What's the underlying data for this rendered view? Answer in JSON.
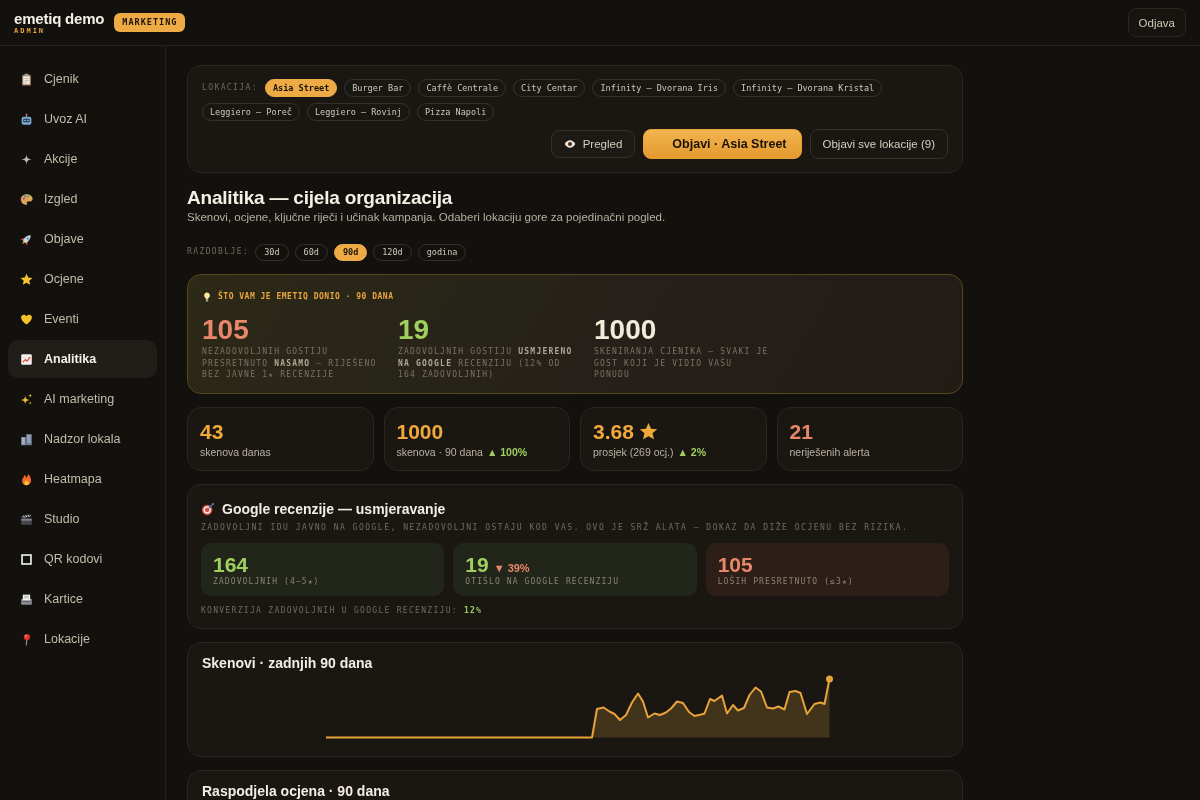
{
  "header": {
    "brand": "emetiq demo",
    "role": "ADMIN",
    "badge": "MARKETING",
    "logout": "Odjava"
  },
  "sidebar": {
    "items": [
      {
        "label": "Cjenik",
        "selected": false
      },
      {
        "label": "Uvoz AI",
        "selected": false
      },
      {
        "label": "Akcije",
        "selected": false
      },
      {
        "label": "Izgled",
        "selected": false
      },
      {
        "label": "Objave",
        "selected": false
      },
      {
        "label": "Ocjene",
        "selected": false
      },
      {
        "label": "Eventi",
        "selected": false
      },
      {
        "label": "Analitika",
        "selected": true
      },
      {
        "label": "AI marketing",
        "selected": false
      },
      {
        "label": "Nadzor lokala",
        "selected": false
      },
      {
        "label": "Heatmapa",
        "selected": false
      },
      {
        "label": "Studio",
        "selected": false
      },
      {
        "label": "QR kodovi",
        "selected": false
      },
      {
        "label": "Kartice",
        "selected": false
      },
      {
        "label": "Lokacije",
        "selected": false
      }
    ]
  },
  "locations": {
    "label": "LOKACIJA:",
    "chips": [
      {
        "label": "Asia Street",
        "selected": true
      },
      {
        "label": "Burger Bar",
        "selected": false
      },
      {
        "label": "Caffè Centrale",
        "selected": false
      },
      {
        "label": "City Centar",
        "selected": false
      },
      {
        "label": "Infinity — Dvorana Iris",
        "selected": false
      },
      {
        "label": "Infinity — Dvorana Kristal",
        "selected": false
      },
      {
        "label": "Leggiero — Poreč",
        "selected": false
      },
      {
        "label": "Leggiero — Rovinj",
        "selected": false
      },
      {
        "label": "Pizza Napoli",
        "selected": false
      }
    ],
    "actions": [
      {
        "label": "Pregled",
        "kind": "preview"
      },
      {
        "label": "Objavi · Asia Street",
        "kind": "primary"
      },
      {
        "label": "Objavi sve lokacije (9)",
        "kind": "secondary"
      }
    ]
  },
  "analytics": {
    "title": "Analitika — cijela organizacija",
    "subtitle": "Skenovi, ocjene, ključne riječi i učinak kampanja. Odaberi lokaciju gore za pojedinačni pogled.",
    "period": {
      "label": "RAZDOBLJE:",
      "options": [
        {
          "label": "30d",
          "selected": false
        },
        {
          "label": "60d",
          "selected": false
        },
        {
          "label": "90d",
          "selected": true
        },
        {
          "label": "120d",
          "selected": false
        },
        {
          "label": "godina",
          "selected": false
        }
      ]
    }
  },
  "highlight": {
    "title": "ŠTO VAM JE EMETIQ DONIO · 90 DANA",
    "stats": [
      {
        "value": "105",
        "color": "#e8876a",
        "text": "NEZADOVOLJNIH GOSTIJU PRESRETNUTO **NASAMO** — RIJEŠENO BEZ JAVNE 1★ RECENZIJE"
      },
      {
        "value": "19",
        "color": "#9fcf5e",
        "text": "ZADOVOLJNIH GOSTIJU **USMJERENO NA GOOGLE** RECENZIJU (12% OD 164 ZADOVOLJNIH)"
      },
      {
        "value": "1000",
        "color": "#f3ebd9",
        "text": "SKENIRANJA CJENIKA — SVAKI JE GOST KOJI JE VIDIO VAŠU PONUDU"
      }
    ]
  },
  "stats": [
    {
      "kind": "count",
      "value": "43",
      "label": "skenova danas"
    },
    {
      "kind": "count",
      "value": "1000",
      "label": "skenova · 90 dana",
      "delta": {
        "text": "▲ 100%",
        "up": true
      }
    },
    {
      "kind": "rating",
      "value": "3.68",
      "label": "prosjek (269 ocj.)",
      "delta": {
        "text": "▲ 2%",
        "up": true
      }
    },
    {
      "kind": "alert",
      "value": "21",
      "label": "neriješenih alerta"
    }
  ],
  "google": {
    "title": "Google recenzije — usmjeravanje",
    "subtitle": "ZADOVOLJNI IDU JAVNO NA GOOGLE, NEZADOVOLJNI OSTAJU KOD VAS. OVO JE SRŽ ALATA — DOKAZ DA DIŽE OCJENU BEZ RIZIKA.",
    "boxes": [
      {
        "kind": "positive",
        "value": "164",
        "label": "ZADOVOLJNIH (4–5★)"
      },
      {
        "kind": "positive",
        "value": "19",
        "label": "OTIŠLO NA GOOGLE RECENZIJU",
        "delta": {
          "text": "▼ 39%",
          "up": false
        }
      },
      {
        "kind": "negative",
        "value": "105",
        "label": "LOŠIH PRESRETNUTO (≤3★)"
      }
    ],
    "conversion": {
      "label": "KONVERZIJA ZADOVOLJNIH U GOOGLE RECENZIJU:",
      "value": "12%"
    }
  },
  "sections": [
    {
      "kind": "scans",
      "title": "Skenovi · zadnjih 90 dana"
    },
    {
      "kind": "ratings",
      "title": "Raspodjela ocjena · 90 dana"
    }
  ]
}
